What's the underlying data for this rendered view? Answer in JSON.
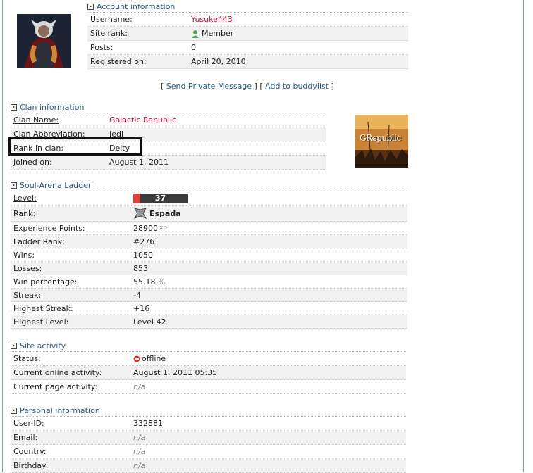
{
  "account": {
    "title": "Account information",
    "rows": [
      {
        "label": "Username:",
        "value": "Yusuke443"
      },
      {
        "label": "Site rank:",
        "value": "Member"
      },
      {
        "label": "Posts:",
        "value": "0"
      },
      {
        "label": "Registered on:",
        "value": "April 20, 2010"
      }
    ]
  },
  "links": {
    "private_message": "Send Private Message",
    "buddylist": "Add to buddylist"
  },
  "clan": {
    "title": "Clan information",
    "rows": [
      {
        "label": "Clan Name:",
        "value": "Galactic Republic"
      },
      {
        "label": "Clan Abbreviation:",
        "value": "Jedi"
      },
      {
        "label": "Rank in clan:",
        "value": "Deity"
      },
      {
        "label": "Joined on:",
        "value": "August 1, 2011"
      }
    ],
    "logo_text": "GRepublic"
  },
  "ladder": {
    "title": "Soul-Arena Ladder",
    "level_value": "37",
    "level_progress": 0.13,
    "rank_value": "Espada",
    "xp_unit": "xp",
    "pct_unit": "%",
    "rows": [
      {
        "label": "Level:"
      },
      {
        "label": "Rank:"
      },
      {
        "label": "Experience Points:",
        "value": "28900"
      },
      {
        "label": "Ladder Rank:",
        "value": "#276"
      },
      {
        "label": "Wins:",
        "value": "1050"
      },
      {
        "label": "Losses:",
        "value": "853"
      },
      {
        "label": "Win percentage:",
        "value": "55.18"
      },
      {
        "label": "Streak:",
        "value": "-4"
      },
      {
        "label": "Highest Streak:",
        "value": "+16"
      },
      {
        "label": "Highest Level:",
        "value": "Level 42"
      }
    ]
  },
  "activity": {
    "title": "Site activity",
    "rows": [
      {
        "label": "Status:",
        "value": "offline"
      },
      {
        "label": "Current online activity:",
        "value": "August 1, 2011 05:35"
      },
      {
        "label": "Current page activity:",
        "value": "n/a"
      }
    ]
  },
  "personal": {
    "title": "Personal information",
    "rows": [
      {
        "label": "User-ID:",
        "value": "332881"
      },
      {
        "label": "Email:",
        "value": "n/a"
      },
      {
        "label": "Country:",
        "value": "n/a"
      },
      {
        "label": "Birthday:",
        "value": "n/a"
      }
    ]
  },
  "colors": {
    "section_title": "#2a5a8c",
    "username_red": "#c8102e",
    "level_bar_fill": "#e53b3b",
    "status_offline": "#d32f2f"
  }
}
